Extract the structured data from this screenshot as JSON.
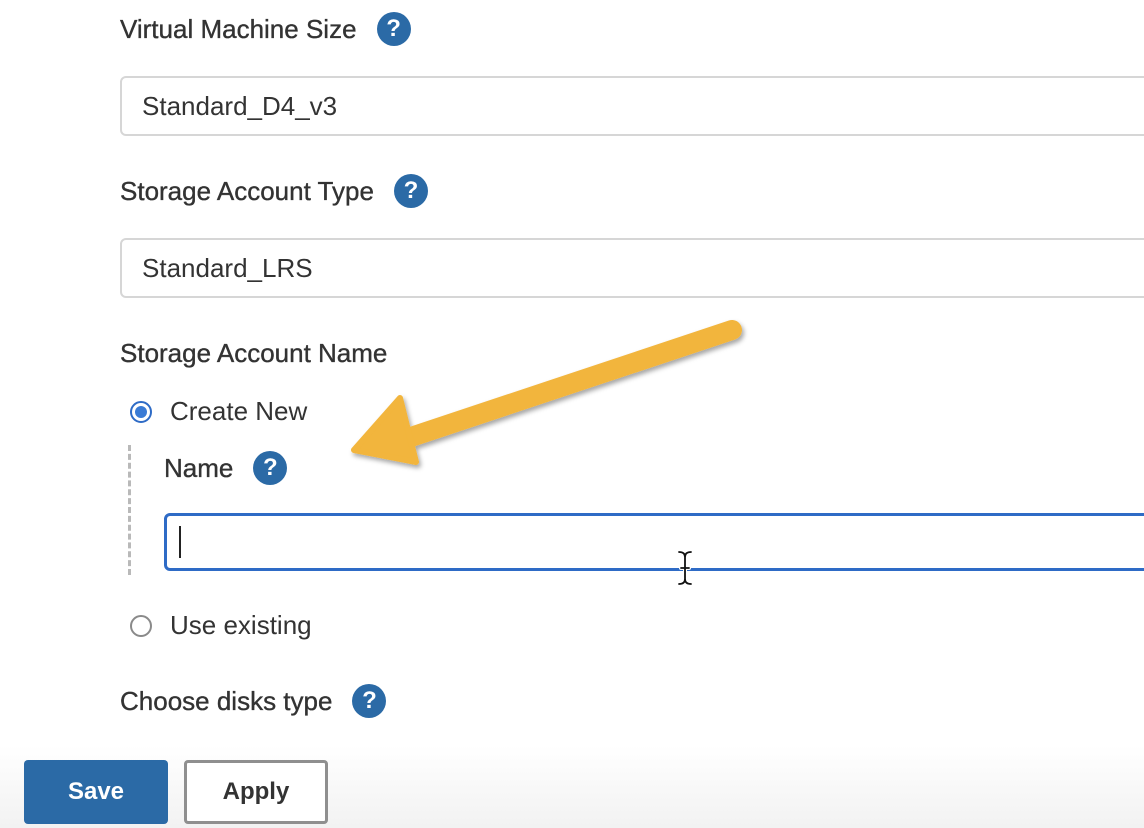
{
  "form": {
    "vm_size": {
      "label": "Virtual Machine Size",
      "value": "Standard_D4_v3"
    },
    "storage_type": {
      "label": "Storage Account Type",
      "value": "Standard_LRS"
    },
    "storage_name": {
      "label": "Storage Account Name",
      "options": [
        {
          "label": "Create New",
          "checked": true
        },
        {
          "label": "Use existing",
          "checked": false
        }
      ],
      "new_name": {
        "label": "Name",
        "value": ""
      }
    },
    "disks_type": {
      "label": "Choose disks type"
    }
  },
  "help_glyph": "?",
  "buttons": {
    "save": "Save",
    "apply": "Apply"
  },
  "colors": {
    "accent": "#2b6aa6",
    "focus_border": "#2e6bc6",
    "annotation_arrow": "#f2b53c"
  },
  "icons": {
    "help": "question-circle-icon",
    "annotation": "annotation-arrow-icon",
    "cursor": "text-cursor-icon"
  }
}
